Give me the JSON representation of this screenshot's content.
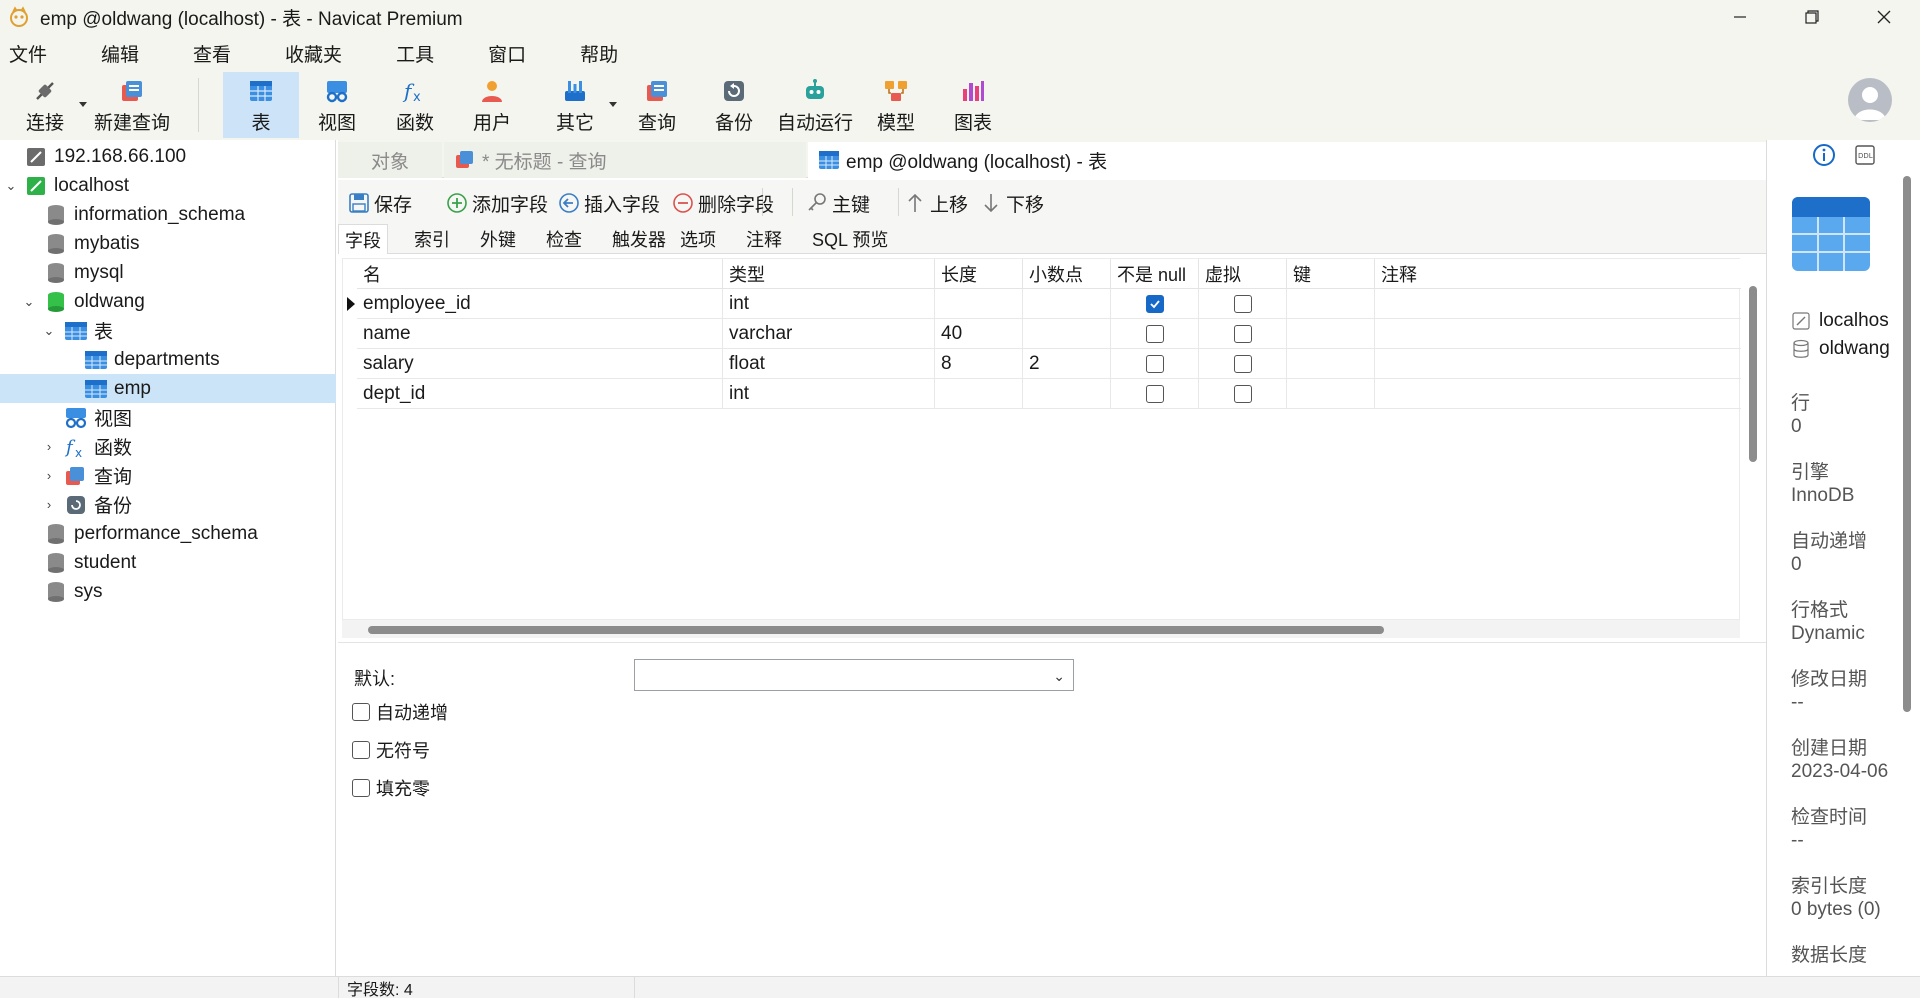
{
  "window": {
    "title": "emp @oldwang (localhost) - 表 - Navicat Premium",
    "controls": {
      "minimize": "—",
      "maximize": "❐",
      "close": "✕"
    }
  },
  "menu": [
    "文件",
    "编辑",
    "查看",
    "收藏夹",
    "工具",
    "窗口",
    "帮助"
  ],
  "toolbar": {
    "items": [
      {
        "label": "连接",
        "icon": "plug-icon"
      },
      {
        "label": "新建查询",
        "icon": "new-query-icon"
      },
      {
        "label": "表",
        "icon": "table-icon",
        "active": true
      },
      {
        "label": "视图",
        "icon": "view-icon"
      },
      {
        "label": "函数",
        "icon": "function-icon"
      },
      {
        "label": "用户",
        "icon": "user-icon"
      },
      {
        "label": "其它",
        "icon": "other-icon"
      },
      {
        "label": "查询",
        "icon": "query-icon"
      },
      {
        "label": "备份",
        "icon": "backup-icon"
      },
      {
        "label": "自动运行",
        "icon": "robot-icon"
      },
      {
        "label": "模型",
        "icon": "model-icon"
      },
      {
        "label": "图表",
        "icon": "chart-icon"
      }
    ]
  },
  "tree": {
    "items": [
      {
        "label": "192.168.66.100",
        "icon": "connection-icon",
        "level": 0,
        "chev": ""
      },
      {
        "label": "localhost",
        "icon": "connection-active-icon",
        "level": 0,
        "chev": "v"
      },
      {
        "label": "information_schema",
        "icon": "database-icon",
        "level": 1,
        "chev": ""
      },
      {
        "label": "mybatis",
        "icon": "database-icon",
        "level": 1,
        "chev": ""
      },
      {
        "label": "mysql",
        "icon": "database-icon",
        "level": 1,
        "chev": ""
      },
      {
        "label": "oldwang",
        "icon": "database-open-icon",
        "level": 1,
        "chev": "v"
      },
      {
        "label": "表",
        "icon": "tables-folder-icon",
        "level": 2,
        "chev": "v"
      },
      {
        "label": "departments",
        "icon": "table-icon",
        "level": 3,
        "chev": ""
      },
      {
        "label": "emp",
        "icon": "table-icon",
        "level": 3,
        "chev": "",
        "selected": true
      },
      {
        "label": "视图",
        "icon": "view-icon",
        "level": 2,
        "chev": ""
      },
      {
        "label": "函数",
        "icon": "function-icon",
        "level": 2,
        "chev": ">"
      },
      {
        "label": "查询",
        "icon": "query-icon",
        "level": 2,
        "chev": ">"
      },
      {
        "label": "备份",
        "icon": "backup-icon",
        "level": 2,
        "chev": ">"
      },
      {
        "label": "performance_schema",
        "icon": "database-icon",
        "level": 1,
        "chev": ""
      },
      {
        "label": "student",
        "icon": "database-icon",
        "level": 1,
        "chev": ""
      },
      {
        "label": "sys",
        "icon": "database-icon",
        "level": 1,
        "chev": ""
      }
    ]
  },
  "tabs": {
    "objects": "对象",
    "query_tab": "* 无标题 - 查询",
    "active_tab": "emp @oldwang (localhost) - 表"
  },
  "actions": {
    "save": "保存",
    "add_field": "添加字段",
    "insert_field": "插入字段",
    "delete_field": "删除字段",
    "primary_key": "主键",
    "move_up": "上移",
    "move_down": "下移"
  },
  "subtabs": [
    "字段",
    "索引",
    "外键",
    "检查",
    "触发器",
    "选项",
    "注释",
    "SQL 预览"
  ],
  "grid": {
    "columns": [
      "名",
      "类型",
      "长度",
      "小数点",
      "不是 null",
      "虚拟",
      "键",
      "注释"
    ],
    "rows": [
      {
        "name": "employee_id",
        "type": "int",
        "length": "",
        "decimals": "",
        "not_null": true,
        "virtual": false,
        "key": "",
        "comment": "",
        "current": true
      },
      {
        "name": "name",
        "type": "varchar",
        "length": "40",
        "decimals": "",
        "not_null": false,
        "virtual": false,
        "key": "",
        "comment": ""
      },
      {
        "name": "salary",
        "type": "float",
        "length": "8",
        "decimals": "2",
        "not_null": false,
        "virtual": false,
        "key": "",
        "comment": ""
      },
      {
        "name": "dept_id",
        "type": "int",
        "length": "",
        "decimals": "",
        "not_null": false,
        "virtual": false,
        "key": "",
        "comment": ""
      }
    ]
  },
  "props": {
    "default_label": "默认:",
    "default_value": "",
    "auto_increment": "自动递增",
    "unsigned": "无符号",
    "zerofill": "填充零"
  },
  "info": {
    "server": "localhos",
    "database": "oldwang",
    "fields": [
      {
        "key": "行",
        "value": "0"
      },
      {
        "key": "引擎",
        "value": "InnoDB"
      },
      {
        "key": "自动递增",
        "value": "0"
      },
      {
        "key": "行格式",
        "value": "Dynamic"
      },
      {
        "key": "修改日期",
        "value": "--"
      },
      {
        "key": "创建日期",
        "value": "2023-04-06"
      },
      {
        "key": "检查时间",
        "value": "--"
      },
      {
        "key": "索引长度",
        "value": "0 bytes (0)"
      },
      {
        "key": "数据长度",
        "value": ""
      }
    ]
  },
  "status": {
    "field_count": "字段数: 4"
  },
  "colors": {
    "accent": "#1769c7",
    "selection": "#cce4f7",
    "chrome": "#f3f5ee"
  }
}
